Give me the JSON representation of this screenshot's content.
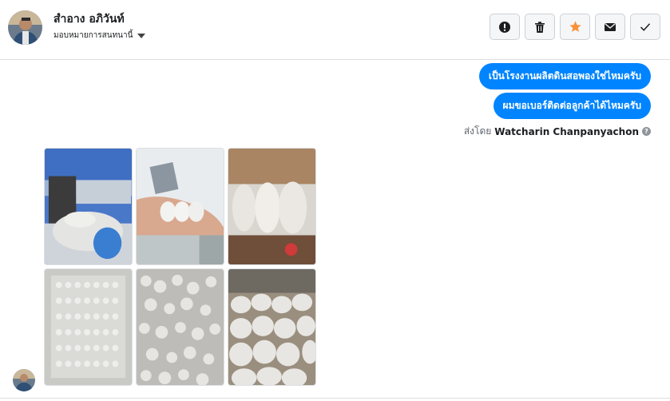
{
  "contact": {
    "name": "สำอาง อภิวันท์",
    "assign_label": "มอบหมายการสนทนานี้"
  },
  "actions": [
    {
      "name": "mark-spam-button",
      "icon": "exclamation-icon"
    },
    {
      "name": "delete-button",
      "icon": "trash-icon"
    },
    {
      "name": "star-button",
      "icon": "star-icon"
    },
    {
      "name": "mark-unread-button",
      "icon": "envelope-icon"
    },
    {
      "name": "mark-done-button",
      "icon": "check-icon"
    }
  ],
  "messages": {
    "outgoing": [
      "เป็นโรงงานผลิตดินสอพองใช่ไหมครับ",
      "ผมขอเบอร์ติดต่อลูกค้าได้ไหมครับ"
    ],
    "sent_by_prefix": "ส่งโดย",
    "sent_by_name": "Watcharin Chanpanyachon"
  },
  "attachments": {
    "count": 6
  },
  "colors": {
    "accent": "#0084ff",
    "star": "#f7923b",
    "border": "#ccd0d5"
  }
}
